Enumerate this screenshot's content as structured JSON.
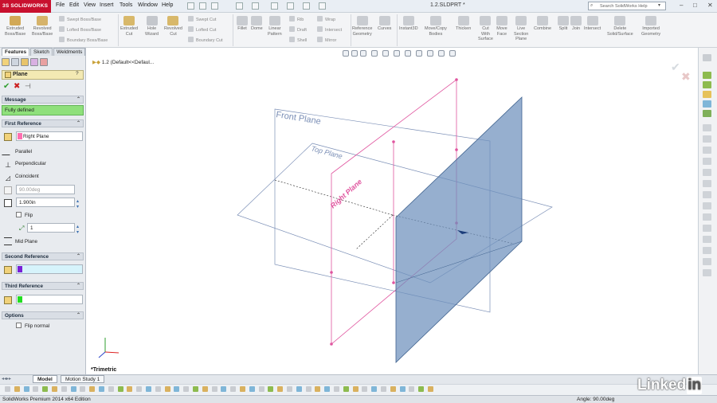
{
  "app": {
    "logo_text": "3S SOLIDWORKS",
    "document_title": "1.2.SLDPRT *",
    "menus": [
      "File",
      "Edit",
      "View",
      "Insert",
      "Tools",
      "Window",
      "Help"
    ],
    "search_placeholder": "Search SolidWorks Help",
    "window_controls": [
      "–",
      "□",
      "✕"
    ]
  },
  "command_manager": {
    "large": [
      {
        "label": "Extruded\nBoss/Base",
        "icon": "extruded-boss-icon",
        "color": "#d2a957"
      },
      {
        "label": "Revolved\nBoss/Base",
        "icon": "revolved-boss-icon",
        "color": "#d6b36a"
      },
      {
        "label": "Extruded\nCut",
        "icon": "extruded-cut-icon",
        "color": "#d8b86a"
      },
      {
        "label": "Hole\nWizard",
        "icon": "hole-wizard-icon",
        "color": "#c4c7cc"
      },
      {
        "label": "Revolved\nCut",
        "icon": "revolved-cut-icon",
        "color": "#d8b86a"
      },
      {
        "label": "Fillet",
        "icon": "fillet-icon",
        "color": "#c9ccd1"
      },
      {
        "label": "Dome",
        "icon": "dome-icon",
        "color": "#c9ccd1"
      },
      {
        "label": "Linear\nPattern",
        "icon": "linear-pattern-icon",
        "color": "#c9ccd1"
      },
      {
        "label": "Reference\nGeometry",
        "icon": "reference-geometry-icon",
        "color": "#c9ccd1"
      },
      {
        "label": "Curves",
        "icon": "curves-icon",
        "color": "#c9ccd1"
      },
      {
        "label": "Instant3D",
        "icon": "instant3d-icon",
        "color": "#c9ccd1"
      },
      {
        "label": "Move/Copy\nBodies",
        "icon": "move-copy-icon",
        "color": "#c9ccd1"
      },
      {
        "label": "Thicken",
        "icon": "thicken-icon",
        "color": "#c9ccd1"
      },
      {
        "label": "Cut\nWith\nSurface",
        "icon": "cut-with-surface-icon",
        "color": "#c9ccd1"
      },
      {
        "label": "Move\nFace",
        "icon": "move-face-icon",
        "color": "#c9ccd1"
      },
      {
        "label": "Live\nSection\nPlane",
        "icon": "live-section-icon",
        "color": "#c9ccd1"
      },
      {
        "label": "Combine",
        "icon": "combine-icon",
        "color": "#c9ccd1"
      },
      {
        "label": "Split",
        "icon": "split-icon",
        "color": "#c9ccd1"
      },
      {
        "label": "Join",
        "icon": "join-icon",
        "color": "#c9ccd1"
      },
      {
        "label": "Intersect",
        "icon": "intersect-icon",
        "color": "#c9ccd1"
      },
      {
        "label": "Delete\nSolid/Surface",
        "icon": "delete-solid-icon",
        "color": "#c9ccd1"
      },
      {
        "label": "Imported\nGeometry",
        "icon": "imported-geometry-icon",
        "color": "#c9ccd1"
      }
    ],
    "small": [
      {
        "label": "Swept Boss/Base"
      },
      {
        "label": "Lofted Boss/Base"
      },
      {
        "label": "Boundary Boss/Base"
      },
      {
        "label": "Swept Cut"
      },
      {
        "label": "Lofted Cut"
      },
      {
        "label": "Boundary Cut"
      },
      {
        "label": "Rib"
      },
      {
        "label": "Draft"
      },
      {
        "label": "Shell"
      },
      {
        "label": "Wrap"
      },
      {
        "label": "Intersect"
      },
      {
        "label": "Mirror"
      }
    ]
  },
  "feature_manager": {
    "tabs": [
      "Features",
      "Sketch",
      "Weldments"
    ],
    "active_tab": "Features",
    "panel_title": "Plane",
    "help_symbol": "?",
    "actions": {
      "ok": "✔",
      "cancel": "✖",
      "pin": "⊣"
    },
    "message": {
      "title": "Message",
      "text": "Fully defined",
      "color": "#8fe07b"
    },
    "first_reference": {
      "title": "First Reference",
      "selection": "Right Plane",
      "selection_color": "#ff6fb0",
      "constraints": [
        "Parallel",
        "Perpendicular",
        "Coincident"
      ],
      "angle_value": "90.00deg",
      "distance_value": "1.900in",
      "flip_label": "Flip",
      "flip_checked": false,
      "instances": "1",
      "mid_plane": "Mid Plane"
    },
    "second_reference": {
      "title": "Second Reference",
      "selection_color": "#7a1fd6"
    },
    "third_reference": {
      "title": "Third Reference",
      "selection_color": "#22dd22"
    },
    "options": {
      "title": "Options",
      "flip_normal": "Flip normal",
      "flip_normal_checked": false
    }
  },
  "viewport": {
    "tree_crumb": "1.2  (Default<<Defaul...",
    "view_orientation": "*Trimetric",
    "plane_labels": {
      "front": "Front Plane",
      "top": "Top Plane",
      "right": "Right Plane"
    },
    "new_plane_color": "#6d90bd"
  },
  "bottom_tabs": [
    "Model",
    "Motion Study 1"
  ],
  "active_bottom_tab": "Model",
  "status": {
    "left": "SolidWorks Premium 2014 x64 Edition",
    "right": "Angle: 90.00deg"
  },
  "watermark": {
    "text": "Linked",
    "box": "in"
  }
}
